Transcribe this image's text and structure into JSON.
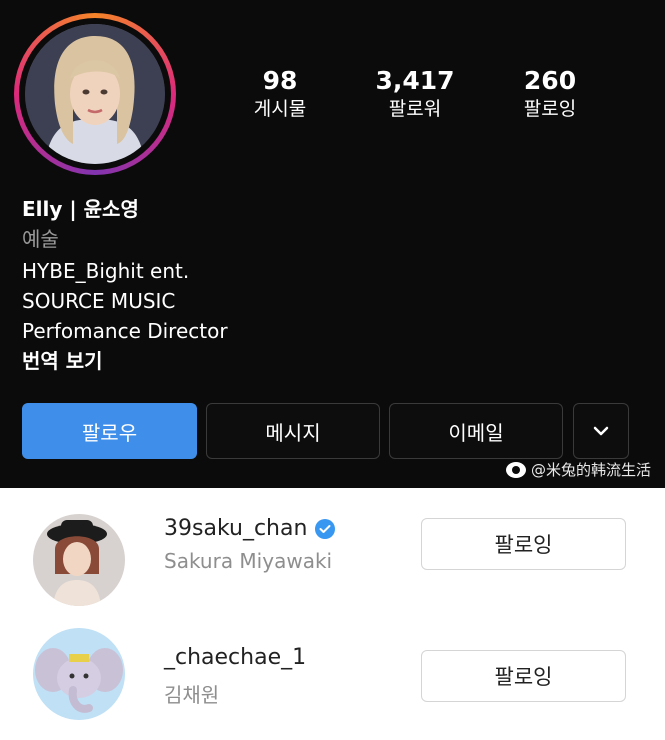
{
  "profile": {
    "name": "Elly | 윤소영",
    "category": "예술",
    "bio_lines": [
      "HYBE_Bighit ent.",
      "SOURCE MUSIC",
      "Perfomance Director"
    ],
    "translate": "번역 보기"
  },
  "stats": [
    {
      "value": "98",
      "label": "게시물"
    },
    {
      "value": "3,417",
      "label": "팔로워"
    },
    {
      "value": "260",
      "label": "팔로잉"
    }
  ],
  "actions": {
    "follow": "팔로우",
    "message": "메시지",
    "email": "이메일",
    "more_icon": "chevron-down-icon"
  },
  "watermark": "@米兔的韩流生活",
  "following_list": [
    {
      "handle": "39saku_chan",
      "name": "Sakura Miyawaki",
      "verified": true,
      "button": "팔로잉"
    },
    {
      "handle": "_chaechae_1",
      "name": "김채원",
      "verified": false,
      "button": "팔로잉"
    }
  ],
  "colors": {
    "background_dark": "#0b0b0b",
    "follow_button": "#3f8fea",
    "verified_badge": "#3897f0",
    "secondary_text": "#8e8e8e"
  }
}
